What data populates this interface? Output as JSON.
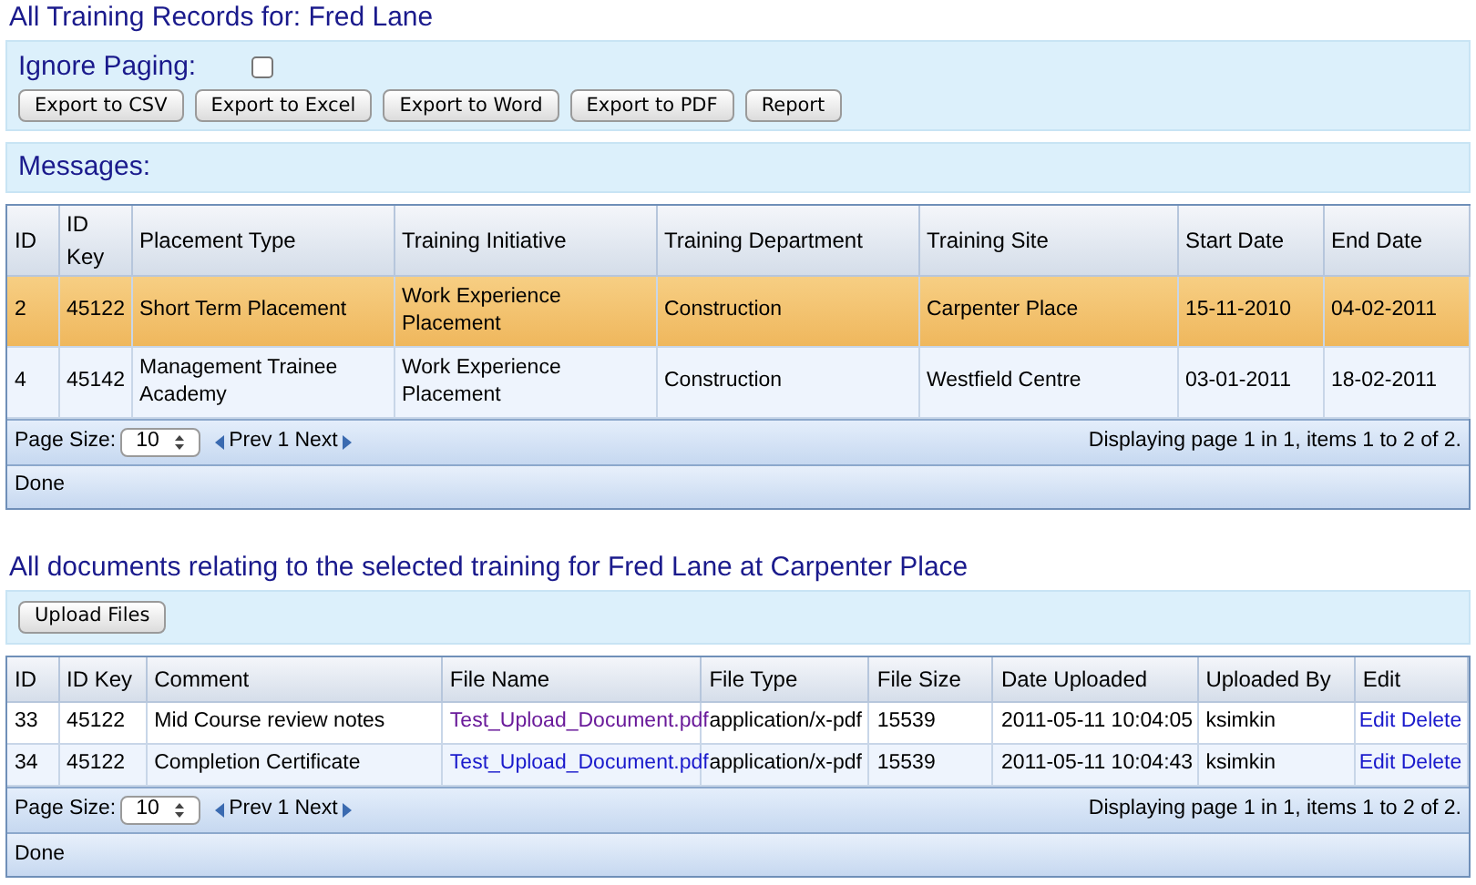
{
  "title": "All Training Records for: Fred Lane",
  "toolbar": {
    "ignore_paging": {
      "label": "Ignore Paging:",
      "checked": false
    },
    "buttons": [
      "Export to CSV",
      "Export to Excel",
      "Export to Word",
      "Export to PDF",
      "Report"
    ]
  },
  "messages": {
    "label": "Messages:"
  },
  "records_table": {
    "columns": [
      "ID",
      "ID Key",
      "Placement Type",
      "Training Initiative",
      "Training Department",
      "Training Site",
      "Start Date",
      "End Date"
    ],
    "rows": [
      {
        "selected": true,
        "cells": [
          "2",
          "45122",
          "Short Term Placement",
          "Work Experience Placement",
          "Construction",
          "Carpenter Place",
          "15-11-2010",
          "04-02-2011"
        ]
      },
      {
        "selected": false,
        "cells": [
          "4",
          "45142",
          "Management Trainee Academy",
          "Work Experience Placement",
          "Construction",
          "Westfield Centre",
          "03-01-2011",
          "18-02-2011"
        ]
      }
    ],
    "pager": {
      "page_size_label": "Page Size:",
      "page_size": "10",
      "prev": "Prev",
      "page": "1",
      "next": "Next",
      "info": "Displaying page 1 in 1, items 1 to 2 of 2."
    },
    "status": "Done"
  },
  "documents": {
    "title": "All documents relating to the selected training for Fred Lane at Carpenter Place",
    "upload_button": "Upload Files",
    "table": {
      "columns": [
        "ID",
        "ID Key",
        "Comment",
        "File Name",
        "File Type",
        "File Size",
        "Date Uploaded",
        "Uploaded By",
        "Edit"
      ],
      "rows": [
        {
          "id": "33",
          "id_key": "45122",
          "comment": "Mid Course review notes",
          "file_name": {
            "text": "Test_Upload_Document.pdf",
            "visited": true
          },
          "file_type": "application/x-pdf",
          "file_size": "15539",
          "date_uploaded": "2011-05-11 10:04:05",
          "uploaded_by": "ksimkin",
          "actions": [
            "Edit",
            "Delete"
          ]
        },
        {
          "id": "34",
          "id_key": "45122",
          "comment": "Completion Certificate",
          "file_name": {
            "text": "Test_Upload_Document.pdf",
            "visited": false
          },
          "file_type": "application/x-pdf",
          "file_size": "15539",
          "date_uploaded": "2011-05-11 10:04:43",
          "uploaded_by": "ksimkin",
          "actions": [
            "Edit",
            "Delete"
          ]
        }
      ]
    },
    "pager": {
      "page_size_label": "Page Size:",
      "page_size": "10",
      "prev": "Prev",
      "page": "1",
      "next": "Next",
      "info": "Displaying page 1 in 1, items 1 to 2 of 2."
    },
    "status": "Done"
  }
}
